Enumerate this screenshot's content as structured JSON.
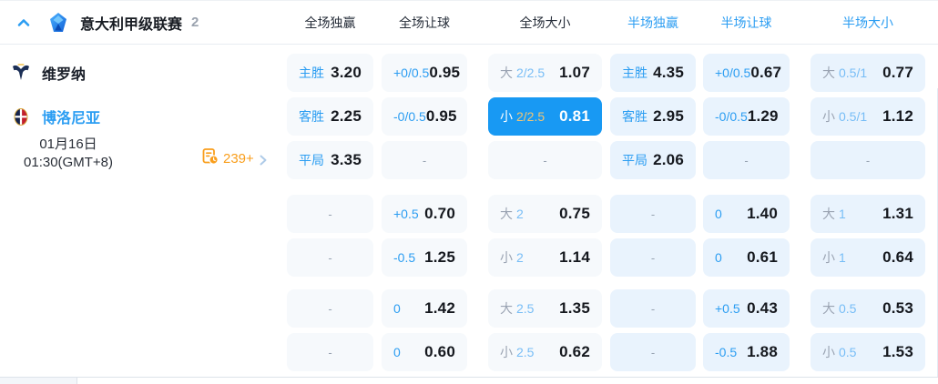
{
  "league_header": {
    "name": "意大利甲级联赛",
    "count": "2",
    "columns": [
      "全场独赢",
      "全场让球",
      "全场大小",
      "半场独赢",
      "半场让球",
      "半场大小"
    ]
  },
  "match": {
    "home_team": "维罗纳",
    "away_team": "博洛尼亚",
    "date": "01月16日",
    "time": "01:30(GMT+8)",
    "more_markets": "239+"
  },
  "colors": {
    "accent_blue": "#2b9df2",
    "selected_bg": "#1899f3",
    "selected_handicap_gold": "#f2c573",
    "handicap_light_blue": "#77bdf6",
    "prefix_gray": "#9aa3b2",
    "markets_orange": "#f99e1c"
  },
  "odds": {
    "groups": [
      {
        "rows": [
          [
            {
              "label": "主胜",
              "value": "3.20"
            },
            {
              "label": "+0/0.5",
              "value": "0.95"
            },
            {
              "prefix": "大",
              "handicap": "2/2.5",
              "value": "1.07"
            },
            {
              "label": "主胜",
              "value": "4.35"
            },
            {
              "label": "+0/0.5",
              "value": "0.67"
            },
            {
              "prefix": "大",
              "handicap": "0.5/1",
              "value": "0.77"
            }
          ],
          [
            {
              "label": "客胜",
              "value": "2.25"
            },
            {
              "label": "-0/0.5",
              "value": "0.95"
            },
            {
              "prefix": "小",
              "handicap": "2/2.5",
              "value": "0.81",
              "selected": true
            },
            {
              "label": "客胜",
              "value": "2.95"
            },
            {
              "label": "-0/0.5",
              "value": "1.29"
            },
            {
              "prefix": "小",
              "handicap": "0.5/1",
              "value": "1.12"
            }
          ],
          [
            {
              "label": "平局",
              "value": "3.35"
            },
            {
              "dash": "-"
            },
            {
              "dash": "-"
            },
            {
              "label": "平局",
              "value": "2.06"
            },
            {
              "dash": "-"
            },
            {
              "dash": "-"
            }
          ]
        ]
      },
      {
        "rows": [
          [
            {
              "dash": "-"
            },
            {
              "label": "+0.5",
              "value": "0.70"
            },
            {
              "prefix": "大",
              "handicap": "2",
              "value": "0.75"
            },
            {
              "dash": "-"
            },
            {
              "label": "0",
              "value": "1.40"
            },
            {
              "prefix": "大",
              "handicap": "1",
              "value": "1.31"
            }
          ],
          [
            {
              "dash": "-"
            },
            {
              "label": "-0.5",
              "value": "1.25"
            },
            {
              "prefix": "小",
              "handicap": "2",
              "value": "1.14"
            },
            {
              "dash": "-"
            },
            {
              "label": "0",
              "value": "0.61"
            },
            {
              "prefix": "小",
              "handicap": "1",
              "value": "0.64"
            }
          ]
        ]
      },
      {
        "rows": [
          [
            {
              "dash": "-"
            },
            {
              "label": "0",
              "value": "1.42"
            },
            {
              "prefix": "大",
              "handicap": "2.5",
              "value": "1.35"
            },
            {
              "dash": "-"
            },
            {
              "label": "+0.5",
              "value": "0.43"
            },
            {
              "prefix": "大",
              "handicap": "0.5",
              "value": "0.53"
            }
          ],
          [
            {
              "dash": "-"
            },
            {
              "label": "0",
              "value": "0.60"
            },
            {
              "prefix": "小",
              "handicap": "2.5",
              "value": "0.62"
            },
            {
              "dash": "-"
            },
            {
              "label": "-0.5",
              "value": "1.88"
            },
            {
              "prefix": "小",
              "handicap": "0.5",
              "value": "1.53"
            }
          ]
        ]
      }
    ]
  }
}
